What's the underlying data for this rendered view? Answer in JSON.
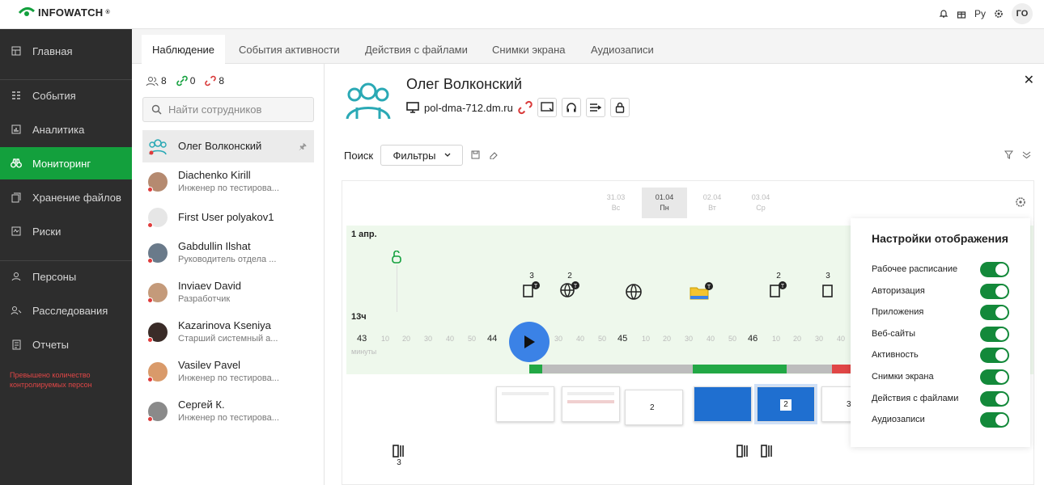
{
  "brand": {
    "name": "INFOWATCH",
    "trademark": "®"
  },
  "topbar": {
    "lang": "Ру",
    "user_initials": "ГО"
  },
  "sidebar": {
    "items": [
      {
        "label": "Главная",
        "icon": "dashboard-icon"
      },
      {
        "label": "События",
        "icon": "events-icon"
      },
      {
        "label": "Аналитика",
        "icon": "chart-icon"
      },
      {
        "label": "Мониторинг",
        "icon": "binoculars-icon",
        "active": true
      },
      {
        "label": "Хранение файлов",
        "icon": "files-icon"
      },
      {
        "label": "Риски",
        "icon": "risk-icon"
      },
      {
        "label": "Персоны",
        "icon": "persons-icon"
      },
      {
        "label": "Расследования",
        "icon": "investigation-icon"
      },
      {
        "label": "Отчеты",
        "icon": "reports-icon"
      }
    ],
    "warning": "Превышено количество контролируемых персон"
  },
  "tabs": [
    {
      "label": "Наблюдение",
      "active": true
    },
    {
      "label": "События активности"
    },
    {
      "label": "Действия с файлами"
    },
    {
      "label": "Снимки экрана"
    },
    {
      "label": "Аудиозаписи"
    }
  ],
  "employees_panel": {
    "counts": {
      "users": "8",
      "online": "0",
      "offline": "8"
    },
    "search_placeholder": "Найти сотрудников",
    "list": [
      {
        "name": "Олег Волконский",
        "role": "",
        "selected": true
      },
      {
        "name": "Diachenko Kirill",
        "role": "Инженер по тестирова..."
      },
      {
        "name": "First User polyakov1",
        "role": ""
      },
      {
        "name": "Gabdullin Ilshat",
        "role": "Руководитель отдела ..."
      },
      {
        "name": "Inviaev David",
        "role": "Разработчик"
      },
      {
        "name": "Kazarinova Kseniya",
        "role": "Старший системный а..."
      },
      {
        "name": "Vasilev Pavel",
        "role": "Инженер по тестирова..."
      },
      {
        "name": "Сергей К.",
        "role": "Инженер по тестирова..."
      }
    ]
  },
  "profile": {
    "name": "Олег Волконский",
    "host": "pol-dma-712.dm.ru"
  },
  "toolbar": {
    "search_label": "Поиск",
    "filters_label": "Фильтры"
  },
  "timeline": {
    "dates": [
      {
        "date": "31.03",
        "day": "Вс"
      },
      {
        "date": "01.04",
        "day": "Пн",
        "active": true
      },
      {
        "date": "02.04",
        "day": "Вт"
      },
      {
        "date": "03.04",
        "day": "Ср"
      }
    ],
    "day_label": "1 апр.",
    "hour_label": "13ч",
    "minutes_label": "минуты",
    "major_ticks": [
      "43",
      "44",
      "45",
      "46"
    ],
    "minor_ticks": [
      "10",
      "20",
      "30",
      "40",
      "50"
    ],
    "event_counts": [
      "3",
      "2",
      "2",
      "3"
    ],
    "thumb_counts": [
      "2",
      "2",
      "3"
    ],
    "bottom_count": "3"
  },
  "display_settings": {
    "title": "Настройки отображения",
    "options": [
      {
        "label": "Рабочее расписание",
        "on": true
      },
      {
        "label": "Авторизация",
        "on": true
      },
      {
        "label": "Приложения",
        "on": true
      },
      {
        "label": "Веб-сайты",
        "on": true
      },
      {
        "label": "Активность",
        "on": true
      },
      {
        "label": "Снимки экрана",
        "on": true
      },
      {
        "label": "Действия с файлами",
        "on": true
      },
      {
        "label": "Аудиозаписи",
        "on": true
      }
    ]
  },
  "colors": {
    "accent": "#13a03d",
    "sidebar": "#2d2d2d",
    "play": "#3b82e6",
    "alert": "#e03c3c"
  }
}
